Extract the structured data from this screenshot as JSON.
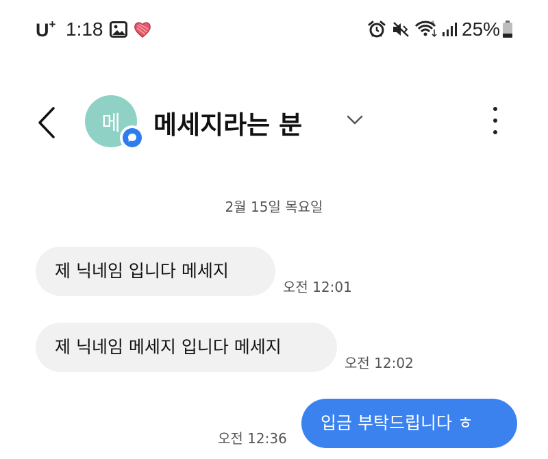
{
  "status_bar": {
    "carrier": "U",
    "carrier_sup": "+",
    "time": "1:18",
    "battery": "25%",
    "icons": [
      "gallery-icon",
      "heart-icon",
      "alarm-icon",
      "mute-icon",
      "wifi-icon",
      "signal-icon",
      "battery-icon"
    ]
  },
  "header": {
    "avatar_initial": "메",
    "contact_name": "메세지라는 분",
    "icons": [
      "back-icon",
      "chevron-down-icon",
      "more-vertical-icon",
      "chat-badge-icon"
    ]
  },
  "conversation": {
    "date": "2월 15일 목요일",
    "messages": [
      {
        "direction": "incoming",
        "text": "제 닉네임 입니다 메세지",
        "time": "오전 12:01"
      },
      {
        "direction": "incoming",
        "text": "제 닉네임 메세지 입니다 메세지",
        "time": "오전 12:02"
      },
      {
        "direction": "outgoing",
        "text": "입금 부탁드립니다 ㅎ",
        "time": "오전 12:36"
      }
    ]
  },
  "colors": {
    "avatar": "#8fd1c4",
    "outgoing_bubble": "#3c82ef",
    "incoming_bubble": "#f1f1f1",
    "badge": "#2f7bf0"
  }
}
